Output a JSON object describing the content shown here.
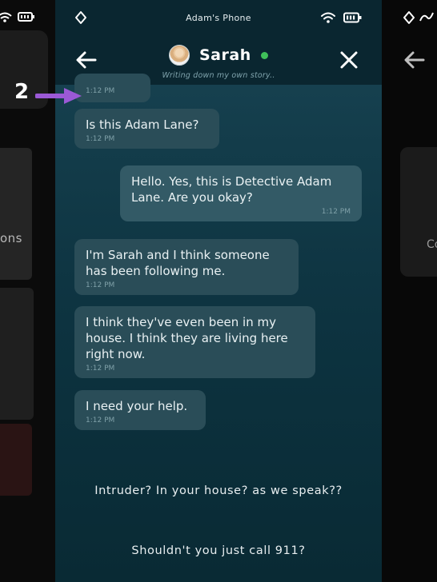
{
  "status_bar": {
    "title": "Adam's Phone"
  },
  "header": {
    "contact_name": "Sarah",
    "subtitle": "Writing down my own story.."
  },
  "messages": [
    {
      "text": "",
      "time": "1:12 PM",
      "from": "contact"
    },
    {
      "text": "Is this Adam Lane?",
      "time": "1:12 PM",
      "from": "contact"
    },
    {
      "text": "Hello. Yes, this is Detective Adam Lane. Are you okay?",
      "time": "1:12 PM",
      "from": "me"
    },
    {
      "text": "I'm Sarah and I think someone has been following me.",
      "time": "1:12 PM",
      "from": "contact"
    },
    {
      "text": "I think they've even been in my house. I think they are living here right now.",
      "time": "1:12 PM",
      "from": "contact"
    },
    {
      "text": "I need your help.",
      "time": "1:12 PM",
      "from": "contact"
    }
  ],
  "choices": [
    "Intruder? In your house? as we speak??",
    "Shouldn't you just call 911?"
  ],
  "annotation": {
    "number": "2"
  },
  "side_panels": {
    "left_text": "ons",
    "right_text": "Co"
  },
  "colors": {
    "online": "#3fbf5a",
    "bubble": "#2a4d58",
    "arrow": "#9b59d6"
  },
  "icons": [
    "wifi-icon",
    "battery-icon",
    "diamond-icon",
    "back-arrow-icon",
    "close-icon"
  ]
}
